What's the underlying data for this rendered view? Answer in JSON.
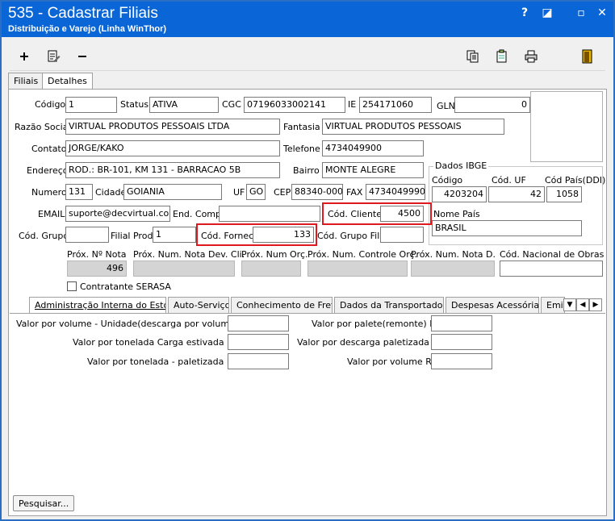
{
  "window": {
    "title": "535 - Cadastrar Filiais",
    "subtitle": "Distribuição e Varejo (Linha WinThor)",
    "controls": [
      "?",
      "◪",
      "▫",
      "✕"
    ]
  },
  "toolbar": {
    "icons": [
      "add-icon",
      "edit-icon",
      "remove-icon",
      "copy-icon",
      "clipboard-icon",
      "print-icon",
      "exit-icon"
    ]
  },
  "main_tabs": [
    "Filiais",
    "Detalhes"
  ],
  "form": {
    "codigo_label": "Código",
    "codigo": "1",
    "status_label": "Status",
    "status": "ATIVA",
    "cgc_label": "CGC",
    "cgc": "07196033002141",
    "ie_label": "IE",
    "ie": "254171060",
    "gln_label": "GLN",
    "gln": "0",
    "razao_label": "Razão Social",
    "razao": "VIRTUAL PRODUTOS PESSOAIS LTDA",
    "fantasia_label": "Fantasia",
    "fantasia": "VIRTUAL PRODUTOS PESSOAIS",
    "contato_label": "Contato",
    "contato": "JORGE/KAKO",
    "telefone_label": "Telefone",
    "telefone": "4734049900",
    "endereco_label": "Endereço",
    "endereco": "ROD.: BR-101, KM 131 - BARRACAO 5B",
    "bairro_label": "Bairro",
    "bairro": "MONTE ALEGRE",
    "numero_label": "Numero",
    "numero": "131",
    "cidade_label": "Cidade",
    "cidade": "GOIANIA",
    "uf_label": "UF",
    "uf": "GO",
    "cep_label": "CEP",
    "cep": "88340-000",
    "fax_label": "FAX",
    "fax": "4734049990",
    "email_label": "EMAIL",
    "email": "suporte@decvirtual.com.b",
    "endcomp_label": "End. Comp.",
    "endcomp": "",
    "codcliente_label": "Cód. Cliente",
    "codcliente": "4500",
    "codgrupo_label": "Cód. Grupo",
    "codgrupo": "",
    "filialprod_label": "Filial Prod.",
    "filialprod": "1",
    "codfornec_label": "Cód. Fornec.",
    "codfornec": "133",
    "codgrupofilial_label": "Cód. Grupo Filial",
    "codgrupofilial": ""
  },
  "ibge": {
    "group_label": "Dados IBGE",
    "codigo_label": "Código",
    "codigo": "4203204",
    "coduf_label": "Cód. UF",
    "coduf": "42",
    "codpais_label": "Cód País(DDI)",
    "codpais": "1058",
    "nomepais_label": "Nome País",
    "nomepais": "BRASIL"
  },
  "proximos": {
    "nota_label": "Próx. Nº Nota",
    "nota": "496",
    "notadev_label": "Próx. Num. Nota Dev. Cli.",
    "notadev": "",
    "orc_label": "Próx. Num Orç.",
    "orc": "",
    "controle_label": "Próx. Num. Controle Orç.",
    "controle": "",
    "notad_label": "Próx. Num. Nota D.",
    "notad": "",
    "obras_label": "Cód. Nacional de Obras",
    "obras": ""
  },
  "serasa_label": "Contratante SERASA",
  "sub_tabs": [
    "Administração Interna do Estoque",
    "Auto-Serviço",
    "Conhecimento de Frete",
    "Dados da Transportadora",
    "Despesas Acessórias",
    "Emiss"
  ],
  "estoque": {
    "left": [
      {
        "label": "Valor por volume - Unidade(descarga por volume)R$:",
        "value": ""
      },
      {
        "label": "Valor por tonelada Carga estivada R$:",
        "value": ""
      },
      {
        "label": "Valor por tonelada - paletizada R$:",
        "value": ""
      }
    ],
    "right": [
      {
        "label": "Valor por palete(remonte) R$:",
        "value": ""
      },
      {
        "label": "Valor por descarga paletizada R$:",
        "value": ""
      },
      {
        "label": "Valor por volume R$:",
        "value": ""
      }
    ]
  },
  "pesquisar_label": "Pesquisar..."
}
